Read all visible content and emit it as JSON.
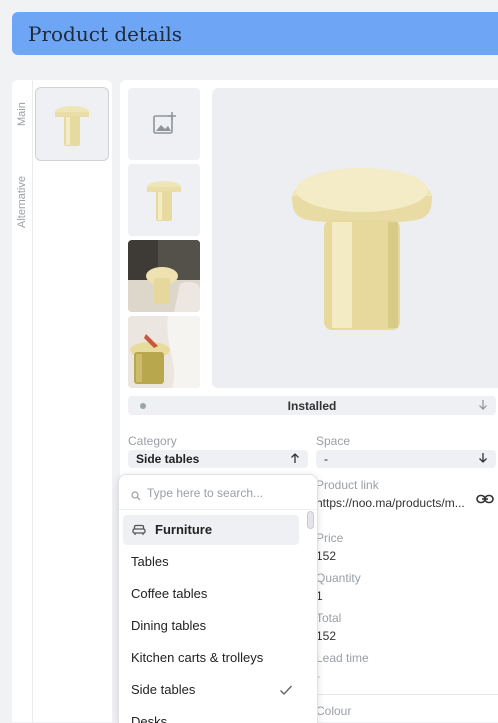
{
  "header": {
    "title": "Product details"
  },
  "gallery": {
    "tabs": [
      "Main",
      "Alternative"
    ]
  },
  "status": {
    "label": "Installed"
  },
  "category": {
    "label": "Category",
    "value": "Side tables"
  },
  "space": {
    "label": "Space",
    "value": "-"
  },
  "product_link": {
    "label": "Product link",
    "value": "https://noo.ma/products/m..."
  },
  "price": {
    "label": "Price",
    "value": "152"
  },
  "quantity": {
    "label": "Quantity",
    "value": "1"
  },
  "total": {
    "label": "Total",
    "value": "152"
  },
  "lead_time": {
    "label": "Lead time",
    "value": "-"
  },
  "colour": {
    "label": "Colour"
  },
  "dropdown": {
    "placeholder": "Type here to search...",
    "group": "Furniture",
    "options": [
      "Tables",
      "Coffee tables",
      "Dining tables",
      "Kitchen carts & trolleys",
      "Side tables",
      "Desks"
    ],
    "selected": "Side tables"
  },
  "colors": {
    "header": "#6ea6f5",
    "product": "#efe6b8"
  }
}
